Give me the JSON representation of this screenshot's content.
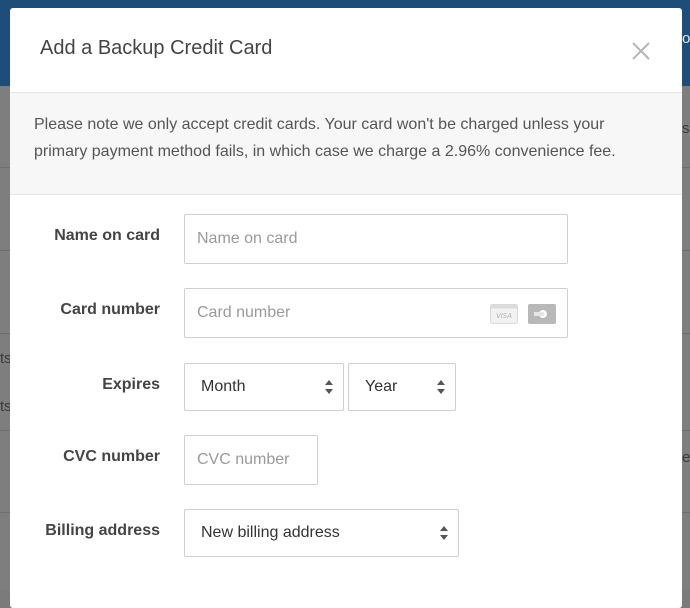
{
  "modal": {
    "title": "Add a Backup Credit Card",
    "notice": "Please note we only accept credit cards. Your card won't be charged unless your primary payment method fails, in which case we charge a 2.96% convenience fee."
  },
  "form": {
    "name": {
      "label": "Name on card",
      "placeholder": "Name on card",
      "value": ""
    },
    "card_number": {
      "label": "Card number",
      "placeholder": "Card number",
      "value": "",
      "icons": [
        "visa-card-icon",
        "generic-card-icon"
      ]
    },
    "expires": {
      "label": "Expires",
      "month": "Month",
      "year": "Year"
    },
    "cvc": {
      "label": "CVC number",
      "placeholder": "CVC number",
      "value": ""
    },
    "billing": {
      "label": "Billing address",
      "value": "New billing address"
    }
  },
  "background": {
    "fragments": [
      "o",
      "s",
      "ts",
      "ts",
      "e"
    ]
  },
  "colors": {
    "topbar": "#1d4d78",
    "overlay": "#7e7e7e"
  }
}
